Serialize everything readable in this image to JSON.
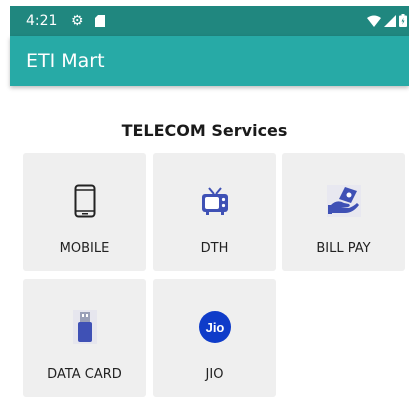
{
  "status_bar": {
    "time": "4:21",
    "icons": [
      "gear-icon",
      "sd-card-icon",
      "wifi-icon",
      "signal-icon",
      "battery-icon"
    ]
  },
  "app_bar": {
    "title": "ETI Mart"
  },
  "section": {
    "title": "TELECOM Services"
  },
  "services": [
    {
      "label": "MOBILE",
      "icon": "mobile-phone-icon"
    },
    {
      "label": "DTH",
      "icon": "tv-icon"
    },
    {
      "label": "BILL PAY",
      "icon": "bill-pay-icon"
    },
    {
      "label": "DATA CARD",
      "icon": "usb-data-card-icon"
    },
    {
      "label": "JIO",
      "icon": "jio-logo-icon",
      "logo_text": "Jio"
    }
  ],
  "colors": {
    "status_bar": "#20877f",
    "app_bar": "#27aaa6",
    "tile_bg": "#efefef",
    "accent_icon": "#3f51b5",
    "jio_blue": "#0f3cc9"
  }
}
